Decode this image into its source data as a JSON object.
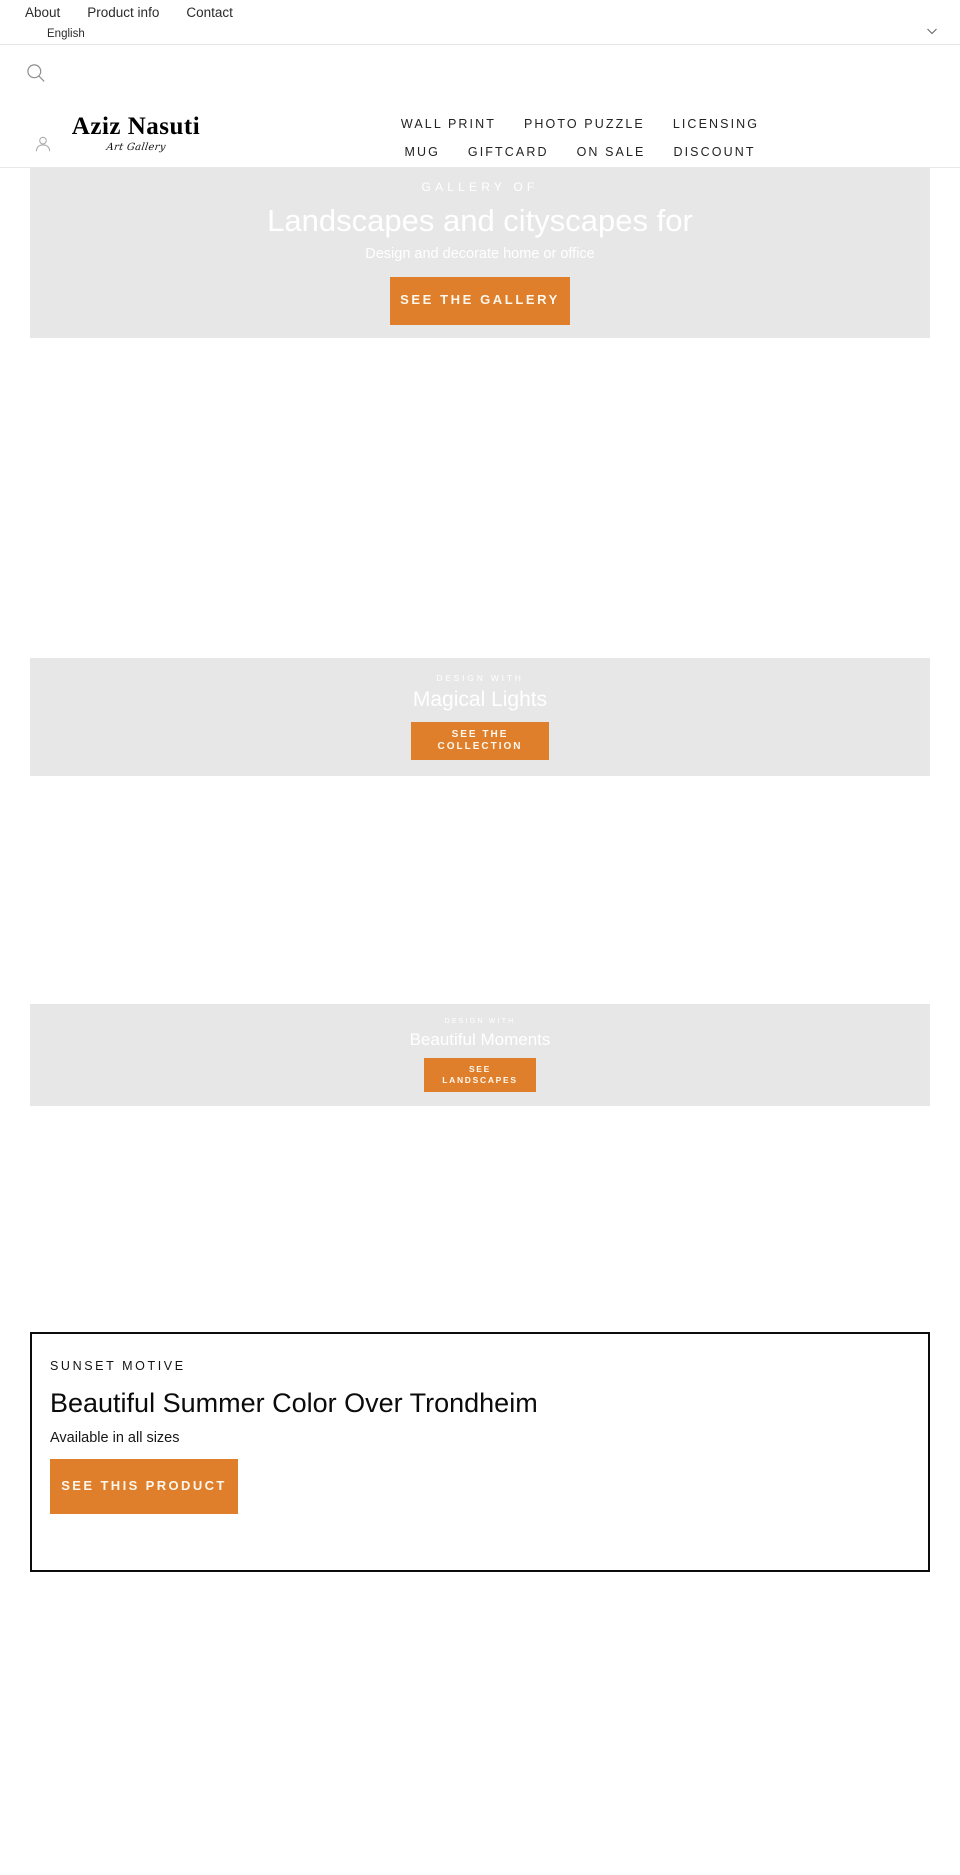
{
  "topbar": {
    "links": [
      {
        "label": "About"
      },
      {
        "label": "Product info"
      },
      {
        "label": "Contact"
      }
    ],
    "language": {
      "selected": "English",
      "caret_icon": "chevron-down-icon"
    }
  },
  "header": {
    "search_icon": "search-icon",
    "account_icon": "user-account-icon",
    "brand": {
      "name": "Aziz Nasuti",
      "tagline": "Art Gallery"
    },
    "nav_rows": [
      [
        {
          "label": "WALL PRINT"
        },
        {
          "label": "PHOTO PUZZLE"
        },
        {
          "label": "LICENSING"
        }
      ],
      [
        {
          "label": "MUG"
        },
        {
          "label": "GIFTCARD"
        },
        {
          "label": "ON SALE"
        },
        {
          "label": "DISCOUNT"
        }
      ]
    ]
  },
  "banners": {
    "hero": {
      "eyebrow": "GALLERY OF",
      "title": "Landscapes and cityscapes for",
      "subtitle": "Design and decorate home or office",
      "cta": "SEE THE GALLERY"
    },
    "lights": {
      "eyebrow": "DESIGN WITH",
      "title": "Magical Lights",
      "cta": "SEE THE COLLECTION"
    },
    "moments": {
      "eyebrow": "DESIGN WITH",
      "title": "Beautiful Moments",
      "cta": "SEE LANDSCAPES"
    }
  },
  "product": {
    "eyebrow": "SUNSET MOTIVE",
    "title": "Beautiful Summer Color Over Trondheim",
    "availability": "Available in all sizes",
    "cta": "SEE THIS PRODUCT"
  },
  "colors": {
    "accent": "#df7f2b",
    "banner_bg": "#e7e7e7",
    "text": "#222222",
    "card_border": "#0c0c0c"
  }
}
